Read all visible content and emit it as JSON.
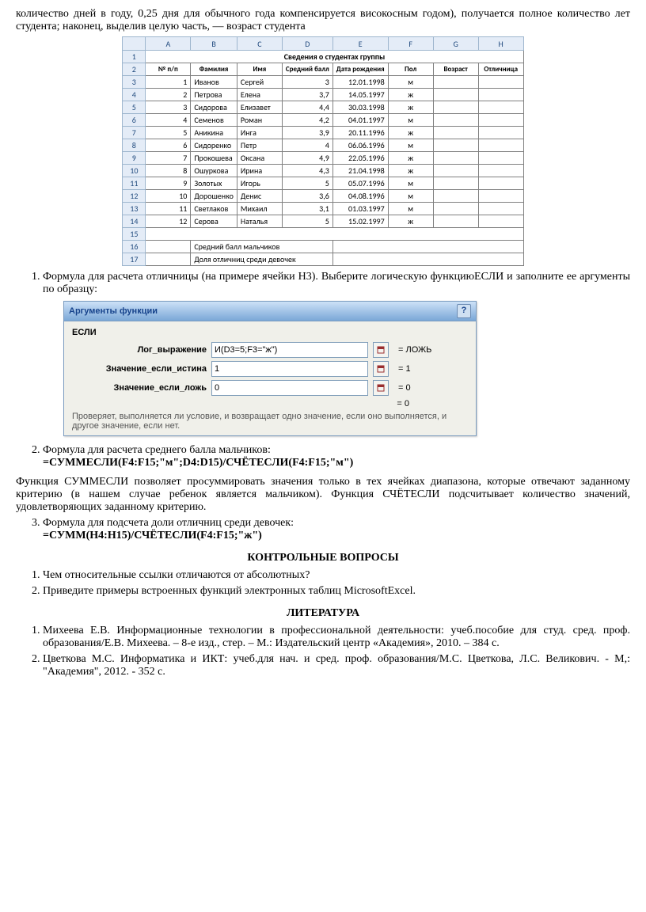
{
  "intro": "количество дней в году, 0,25 дня для обычного года компенсируется високосным годом), получается полное количество лет студента; наконец, выделив целую часть, — возраст студента",
  "sheet": {
    "cols": [
      "A",
      "B",
      "C",
      "D",
      "E",
      "F",
      "G",
      "H"
    ],
    "title": "Сведения о студентах группы",
    "headers": [
      "№ п/п",
      "Фамилия",
      "Имя",
      "Средний балл",
      "Дата рождения",
      "Пол",
      "Возраст",
      "Отличница"
    ],
    "rows": [
      {
        "n": "1",
        "fam": "Иванов",
        "im": "Сергей",
        "ball": "3",
        "dob": "12.01.1998",
        "sex": "м"
      },
      {
        "n": "2",
        "fam": "Петрова",
        "im": "Елена",
        "ball": "3,7",
        "dob": "14.05.1997",
        "sex": "ж"
      },
      {
        "n": "3",
        "fam": "Сидорова",
        "im": "Елизавет",
        "ball": "4,4",
        "dob": "30.03.1998",
        "sex": "ж"
      },
      {
        "n": "4",
        "fam": "Семенов",
        "im": "Роман",
        "ball": "4,2",
        "dob": "04.01.1997",
        "sex": "м"
      },
      {
        "n": "5",
        "fam": "Аникина",
        "im": "Инга",
        "ball": "3,9",
        "dob": "20.11.1996",
        "sex": "ж"
      },
      {
        "n": "6",
        "fam": "Сидоренко",
        "im": "Петр",
        "ball": "4",
        "dob": "06.06.1996",
        "sex": "м"
      },
      {
        "n": "7",
        "fam": "Прокошева",
        "im": "Оксана",
        "ball": "4,9",
        "dob": "22.05.1996",
        "sex": "ж"
      },
      {
        "n": "8",
        "fam": "Ошуркова",
        "im": "Ирина",
        "ball": "4,3",
        "dob": "21.04.1998",
        "sex": "ж"
      },
      {
        "n": "9",
        "fam": "Золотых",
        "im": "Игорь",
        "ball": "5",
        "dob": "05.07.1996",
        "sex": "м"
      },
      {
        "n": "10",
        "fam": "Дорошенко",
        "im": "Денис",
        "ball": "3,6",
        "dob": "04.08.1996",
        "sex": "м"
      },
      {
        "n": "11",
        "fam": "Светлаков",
        "im": "Михаил",
        "ball": "3,1",
        "dob": "01.03.1997",
        "sex": "м"
      },
      {
        "n": "12",
        "fam": "Серова",
        "im": "Наталья",
        "ball": "5",
        "dob": "15.02.1997",
        "sex": "ж"
      }
    ],
    "footer1": "Средний балл мальчиков",
    "footer2": "Доля отличниц среди девочек"
  },
  "step1": "Формула для расчета отличницы (на примере ячейки H3). Выберите логическую функциюЕСЛИ и заполните ее аргументы по образцу:",
  "dlg": {
    "title": "Аргументы функции",
    "fn": "ЕСЛИ",
    "labels": {
      "log": "Лог_выражение",
      "t": "Значение_если_истина",
      "f": "Значение_если_ложь"
    },
    "vals": {
      "log": "И(D3=5;F3=\"ж\")",
      "t": "1",
      "f": "0"
    },
    "results": {
      "log": "= ЛОЖЬ",
      "t": "= 1",
      "f": "= 0",
      "final": "= 0"
    },
    "desc": "Проверяет, выполняется ли условие, и возвращает одно значение, если оно выполняется, и другое значение, если нет."
  },
  "step2a": "Формула для расчета среднего балла мальчиков:",
  "step2b": "=СУММЕСЛИ(F4:F15;\"м\";D4:D15)/СЧЁТЕСЛИ(F4:F15;\"м\")",
  "para2": "Функция СУММЕСЛИ позволяет просуммировать значения только в тех ячейках диапазона, которые отвечают заданному критерию (в нашем случае ребенок является мальчиком). Функция СЧЁТЕСЛИ подсчитывает количество значений, удовлетворяющих заданному критерию.",
  "step3a": "Формула для подсчета доли отличниц среди девочек:",
  "step3b": "=СУММ(H4:H15)/СЧЁТЕСЛИ(F4:F15;\"ж\")",
  "h_questions": "КОНТРОЛЬНЫЕ ВОПРОСЫ",
  "q1": "Чем относительные ссылки отличаются от абсолютных?",
  "q2": "Приведите примеры встроенных функций электронных таблиц MicrosoftExcel.",
  "h_lit": "ЛИТЕРАТУРА",
  "lit1": "Михеева Е.В. Информационные технологии в профессиональной деятельности: учеб.пособие для студ. сред. проф. образования/Е.В. Михеева. – 8-е изд., стер. – М.: Издательский центр «Академия», 2010. – 384 с.",
  "lit2": "Цветкова М.С. Информатика и ИКТ: учеб.для нач. и сред. проф. образования/М.С. Цветкова, Л.С. Великович. - М,: \"Академия\", 2012. - 352 с."
}
